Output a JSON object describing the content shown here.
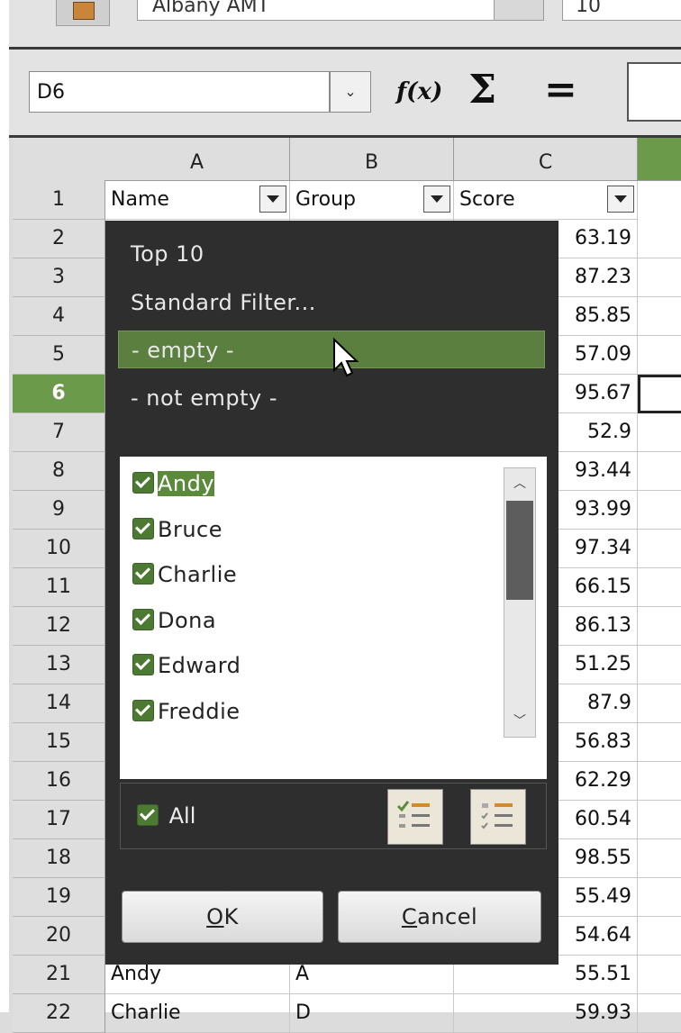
{
  "toolbar": {
    "font_name": "Albany AMT",
    "font_size": "10"
  },
  "formula_bar": {
    "name_box": "D6",
    "fx_label": "f(x)",
    "sum_label": "Σ",
    "equals_label": "="
  },
  "columns": [
    {
      "label": "A"
    },
    {
      "label": "B"
    },
    {
      "label": "C"
    }
  ],
  "header_row": [
    "Name",
    "Group",
    "Score"
  ],
  "rows": [
    {
      "num": "1"
    },
    {
      "num": "2",
      "score": "63.19"
    },
    {
      "num": "3",
      "score": "87.23"
    },
    {
      "num": "4",
      "score": "85.85"
    },
    {
      "num": "5",
      "score": "57.09"
    },
    {
      "num": "6",
      "score": "95.67"
    },
    {
      "num": "7",
      "score": "52.9"
    },
    {
      "num": "8",
      "score": "93.44"
    },
    {
      "num": "9",
      "score": "93.99"
    },
    {
      "num": "10",
      "score": "97.34"
    },
    {
      "num": "11",
      "score": "66.15"
    },
    {
      "num": "12",
      "score": "86.13"
    },
    {
      "num": "13",
      "score": "51.25"
    },
    {
      "num": "14",
      "score": "87.9"
    },
    {
      "num": "15",
      "score": "56.83"
    },
    {
      "num": "16",
      "score": "62.29"
    },
    {
      "num": "17",
      "score": "60.54"
    },
    {
      "num": "18",
      "score": "98.55"
    },
    {
      "num": "19",
      "score": "55.49"
    },
    {
      "num": "20",
      "score": "54.64"
    },
    {
      "num": "21",
      "name": "Andy",
      "group": "A",
      "score": "55.51"
    },
    {
      "num": "22",
      "name": "Charlie",
      "group": "D",
      "score": "59.93"
    }
  ],
  "filter_popup": {
    "menu": [
      "Top 10",
      "Standard Filter...",
      "- empty -",
      "- not empty -"
    ],
    "highlighted_index": 2,
    "values": [
      "Andy",
      "Bruce",
      "Charlie",
      "Dona",
      "Edward",
      "Freddie"
    ],
    "all_label": "All",
    "ok_key": "O",
    "ok_rest": "K",
    "cancel_key": "C",
    "cancel_rest": "ancel"
  },
  "colors": {
    "accent": "#5a7f3f",
    "popup_bg": "#2e2e2e",
    "selected_header": "#6a9a4a"
  }
}
